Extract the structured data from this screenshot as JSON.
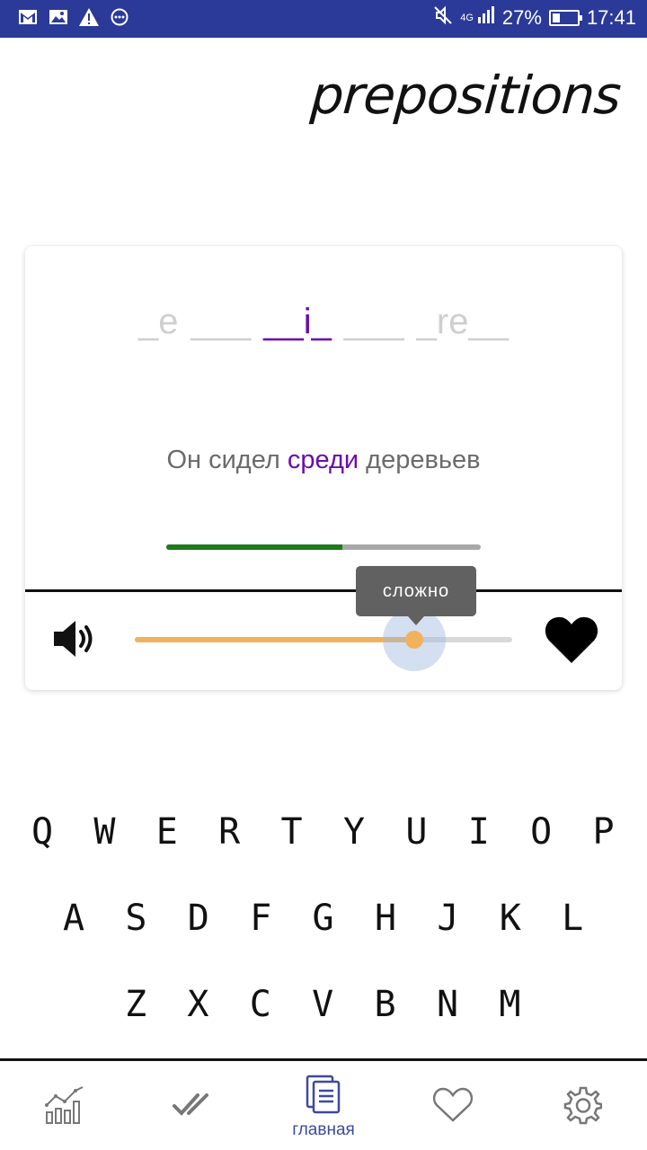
{
  "status_bar": {
    "network": "4G",
    "battery": "27%",
    "battery_level": 0.27,
    "time": "17:41"
  },
  "title": "prepositions",
  "card": {
    "word_blanks": [
      "_e",
      "___",
      "__i_",
      "___",
      "_re__"
    ],
    "active_index": 2,
    "sentence": {
      "before": "Он сидел ",
      "highlight": "среди",
      "after": " деревьев"
    },
    "progress": 0.56,
    "difficulty": {
      "label": "сложно",
      "value": 0.74
    }
  },
  "keyboard": {
    "rows": [
      [
        "Q",
        "W",
        "E",
        "R",
        "T",
        "Y",
        "U",
        "I",
        "O",
        "P"
      ],
      [
        "A",
        "S",
        "D",
        "F",
        "G",
        "H",
        "J",
        "K",
        "L"
      ],
      [
        "Z",
        "X",
        "C",
        "V",
        "B",
        "N",
        "M"
      ]
    ]
  },
  "nav": {
    "items": [
      {
        "icon": "stats-icon",
        "label": ""
      },
      {
        "icon": "double-check-icon",
        "label": ""
      },
      {
        "icon": "cards-icon",
        "label": "главная",
        "active": true
      },
      {
        "icon": "heart-outline-icon",
        "label": ""
      },
      {
        "icon": "gear-icon",
        "label": ""
      }
    ]
  },
  "colors": {
    "status_bar": "#2b3a99",
    "accent": "#6a0dad",
    "progress": "#1f7a1f",
    "slider": "#f1b25b",
    "nav_active": "#3d4aa0"
  }
}
